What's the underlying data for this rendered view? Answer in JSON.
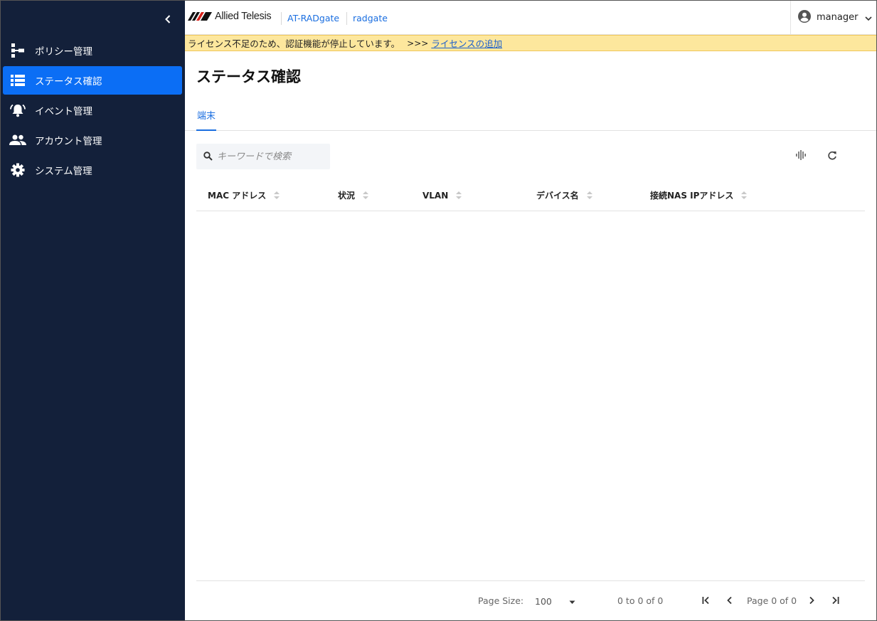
{
  "sidebar": {
    "collapse_icon": "chevron-left-icon",
    "items": [
      {
        "label": "ポリシー管理",
        "icon": "policy-tree-icon"
      },
      {
        "label": "ステータス確認",
        "icon": "list-icon",
        "active": true
      },
      {
        "label": "イベント管理",
        "icon": "bell-icon"
      },
      {
        "label": "アカウント管理",
        "icon": "people-icon"
      },
      {
        "label": "システム管理",
        "icon": "gear-icon"
      }
    ],
    "bg_color": "#13203a",
    "active_color": "#0b6ef5"
  },
  "header": {
    "brand": "Allied Telesis",
    "product": "AT-RADgate",
    "host": "radgate",
    "user": "manager"
  },
  "banner": {
    "message": "ライセンス不足のため、認証機能が停止しています。",
    "arrows": ">>>",
    "link": "ライセンスの追加",
    "bg_color": "#fde79d"
  },
  "main": {
    "title": "ステータス確認",
    "tabs": [
      {
        "label": "端末"
      }
    ],
    "search": {
      "placeholder": "キーワードで検索"
    },
    "columns": [
      {
        "label": "MAC アドレス"
      },
      {
        "label": "状況"
      },
      {
        "label": "VLAN"
      },
      {
        "label": "デバイス名"
      },
      {
        "label": "接続NAS IPアドレス"
      }
    ],
    "rows": []
  },
  "footer": {
    "page_size_label": "Page Size:",
    "page_size": "100",
    "range": "0 to 0 of 0",
    "page_text": "Page 0 of 0"
  }
}
